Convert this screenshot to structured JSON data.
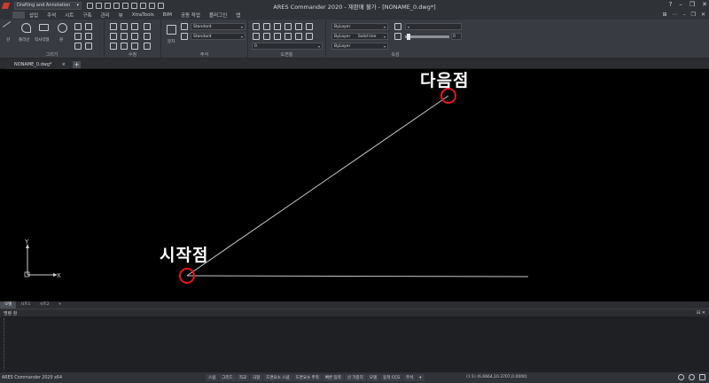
{
  "window": {
    "title": "ARES Commander 2020 - 재판매 불가 - [NONAME_0.dwg*]",
    "workspace": "Drafting and Annotation",
    "controls": [
      "?",
      "–",
      "❐",
      "✕"
    ]
  },
  "menu": {
    "tabs": [
      "삽입",
      "주석",
      "시트",
      "구축",
      "관리",
      "뷰",
      "XtraTools",
      "BIM",
      "공동 작업",
      "플러그인",
      "앱"
    ],
    "right_controls": [
      "⊞",
      "⋯",
      "–",
      "❐",
      "✕"
    ]
  },
  "ribbon": {
    "panels": {
      "draw": "그리기",
      "modify": "수정",
      "annotation": "주석",
      "entity_properties": "도면층",
      "properties": "속성"
    },
    "draw_labels": {
      "line": "선",
      "polyline": "폴리선",
      "rectangle": "직사각형",
      "circle": "원"
    },
    "text_label": "문자",
    "text_style": "Standard",
    "dim_style": "Standard",
    "layer_value": "0",
    "color_value": "ByLayer",
    "linetype_layer": "ByLayer",
    "linetype_value": "Solid line",
    "lineweight_value": "ByLayer",
    "transparency_value": "0"
  },
  "document": {
    "tab_label": "NONAME_0.dwg*",
    "tab_close": "×",
    "add_tab": "+"
  },
  "canvas": {
    "background": "#000000",
    "annotations": {
      "start_point": "시작점",
      "next_point": "다음점"
    },
    "ucs": {
      "x_label": "X",
      "y_label": "Y"
    }
  },
  "layout_tabs": [
    "모델",
    "시트1",
    "시트2",
    "+"
  ],
  "command_window": {
    "title": "명령 창",
    "controls": "⊟ ✕"
  },
  "status": {
    "app_label": "ARES Commander 2020 x64",
    "buttons": [
      "스냅",
      "그리드",
      "직교",
      "극형",
      "도면요소 스냅",
      "도면요소 추적",
      "빠른 입력",
      "선 가중치",
      "모델",
      "동적 CCS",
      "주석"
    ],
    "scale": "(1:1)",
    "coords": "(6.6664,10.3707,0.0000)"
  },
  "colors": {
    "accent_red": "#e8141e",
    "drawn_line": "#c8c8c8"
  }
}
